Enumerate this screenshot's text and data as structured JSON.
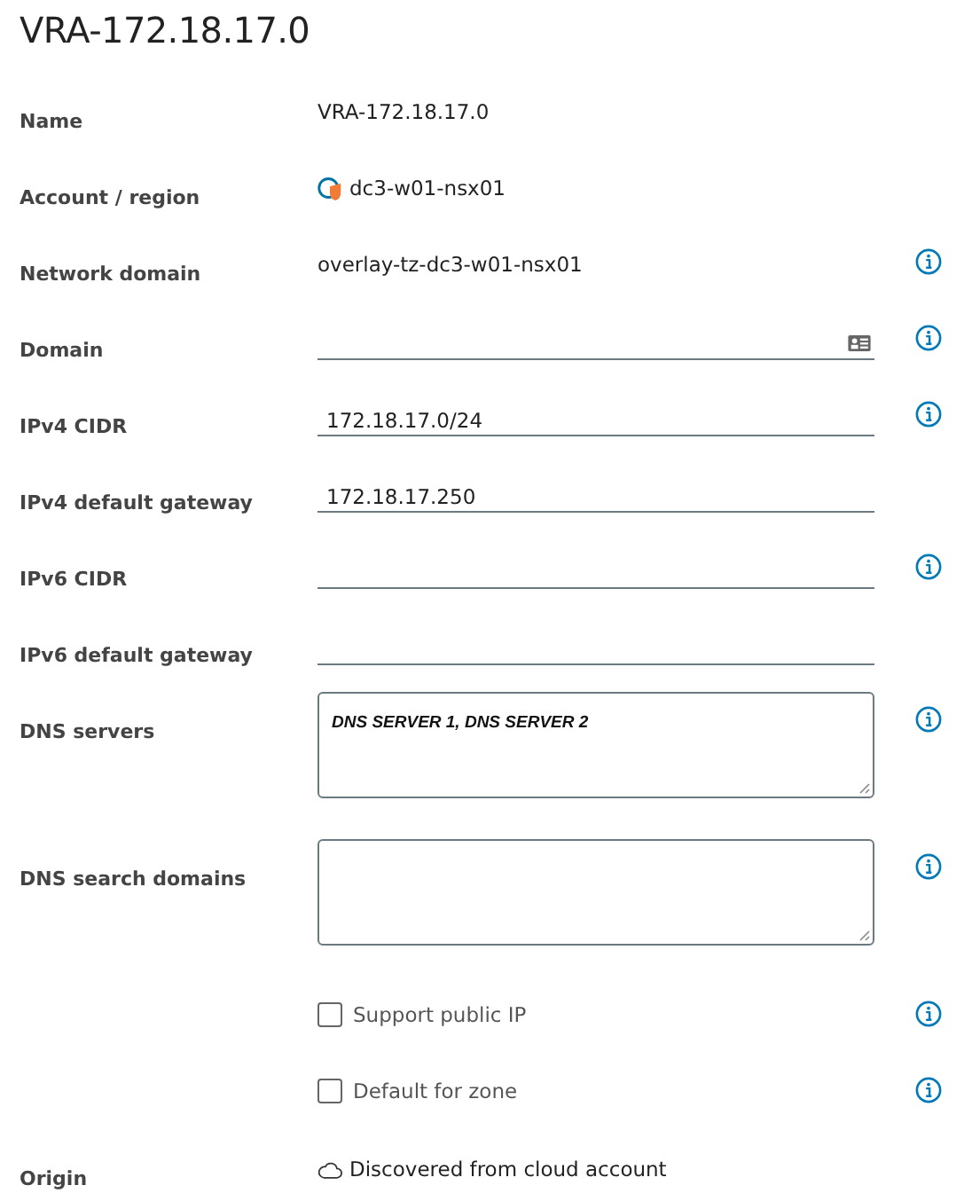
{
  "title": "VRA-172.18.17.0",
  "rows": [
    {
      "kind": "text",
      "label": "Name",
      "value": "VRA-172.18.17.0",
      "info": false
    },
    {
      "kind": "account",
      "label": "Account / region",
      "value": "dc3-w01-nsx01",
      "info": false
    },
    {
      "kind": "text",
      "label": "Network domain",
      "value": "overlay-tz-dc3-w01-nsx01",
      "info": true
    },
    {
      "kind": "picker",
      "label": "Domain",
      "info": true
    },
    {
      "kind": "input",
      "label": "IPv4 CIDR",
      "value": "172.18.17.0/24",
      "info": true
    },
    {
      "kind": "input",
      "label": "IPv4 default gateway",
      "value": "172.18.17.250",
      "info": false
    },
    {
      "kind": "input",
      "label": "IPv6 CIDR",
      "info": true
    },
    {
      "kind": "input",
      "label": "IPv6 default gateway",
      "info": false
    },
    {
      "kind": "textarea",
      "label": "DNS servers",
      "value": "DNS SERVER 1, DNS SERVER 2",
      "info": true
    },
    {
      "kind": "textarea",
      "label": "DNS search domains",
      "info": true
    },
    {
      "kind": "checkbox",
      "text": "Support public IP",
      "checked": false,
      "info": true
    },
    {
      "kind": "checkbox",
      "text": "Default for zone",
      "checked": false,
      "info": true
    },
    {
      "kind": "origin",
      "label": "Origin",
      "value": "Discovered from cloud account",
      "info": false
    }
  ]
}
